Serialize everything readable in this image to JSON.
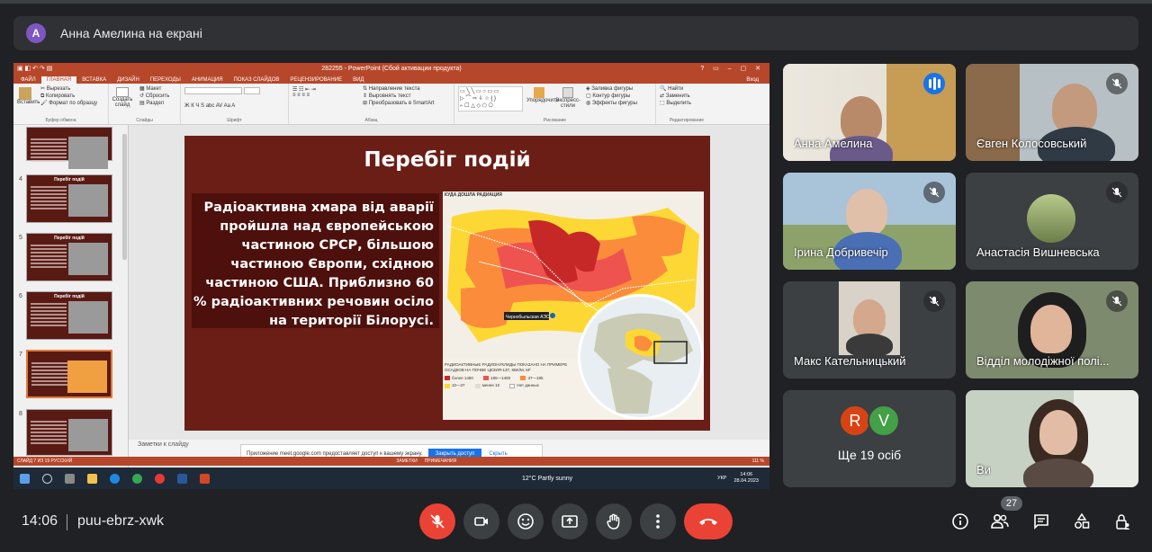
{
  "presenter": {
    "initial": "А",
    "label": "Анна Амелина на екрані"
  },
  "powerpoint": {
    "title": "282255 - PowerPoint (Сбой активации продукта)",
    "tabs": [
      "ФАЙЛ",
      "ГЛАВНАЯ",
      "ВСТАВКА",
      "ДИЗАЙН",
      "ПЕРЕХОДЫ",
      "АНИМАЦИЯ",
      "ПОКАЗ СЛАЙДОВ",
      "РЕЦЕНЗИРОВАНИЕ",
      "ВИД"
    ],
    "login": "Вход",
    "ribbon": {
      "clipboard": {
        "paste": "Вставить",
        "cut": "Вырезать",
        "copy": "Копировать",
        "format": "Формат по образцу",
        "label": "Буфер обмена"
      },
      "slides": {
        "new": "Создать слайд",
        "layout": "Макет",
        "reset": "Сбросить",
        "section": "Раздел",
        "label": "Слайды"
      },
      "font": {
        "label": "Шрифт"
      },
      "paragraph": {
        "direction": "Направление текста",
        "align": "Выровнять текст",
        "smartart": "Преобразовать в SmartArt",
        "label": "Абзац"
      },
      "drawing": {
        "arrange": "Упорядочить",
        "quick": "Экспресс-стили",
        "fill": "Заливка фигуры",
        "outline": "Контур фигуры",
        "effects": "Эффекты фигуры",
        "label": "Рисование"
      },
      "editing": {
        "find": "Найти",
        "replace": "Заменить",
        "select": "Выделить",
        "label": "Редактирование"
      }
    },
    "thumbnails": [
      {
        "num": "",
        "title": ""
      },
      {
        "num": "4",
        "title": "Перебіг подій"
      },
      {
        "num": "5",
        "title": "Перебіг подій"
      },
      {
        "num": "6",
        "title": "Перебіг подій"
      },
      {
        "num": "7",
        "title": "Перебіг подій"
      },
      {
        "num": "8",
        "title": ""
      }
    ],
    "slide": {
      "title": "Перебіг подій",
      "text": "Радіоактивна хмара від аварії пройшла над європейською частиною СРСР, більшою частиною Європи, східною частиною США. Приблизно 60 % радіоактивних речовин осіло на території Білорусі.",
      "map": {
        "heading": "КУДА ДОШЛА РАДИАЦИЯ",
        "plant_label": "Чернобыльская АЭС",
        "legend_title": "РАДИОАКТИВНЫЕ РАДИОНУКЛИДЫ ПОКАЗАНО НА ПРИМЕРЕ ОСАДКОВ НА ПОЧВЕ ЦЕЗИЯ-137, КБК/М, М²",
        "legend": [
          {
            "label": "более 1480",
            "color": "#c62828"
          },
          {
            "label": "185—1480",
            "color": "#ef5350"
          },
          {
            "label": "37—185",
            "color": "#fb8c3c"
          },
          {
            "label": "10—37",
            "color": "#fdd835"
          },
          {
            "label": "менее 10",
            "color": "#e0dcd0"
          },
          {
            "label": "Нет данных",
            "color": "#ffffff"
          }
        ]
      }
    },
    "notes_placeholder": "Заметки к слайду",
    "share_banner": {
      "text": "Приложение meet.google.com предоставляет доступ к вашему экрану.",
      "allow": "Закрыть доступ",
      "hide": "Скрыть"
    },
    "status": {
      "left": "СЛАЙД 7 ИЗ 19    РУССКИЙ",
      "notes": "ЗАМЕТКИ",
      "comments": "ПРИМЕЧАНИЯ",
      "zoom": "111 %"
    },
    "taskbar": {
      "weather": "12°C  Partly sunny",
      "lang": "УКР",
      "time": "14:06",
      "date": "28.04.2023"
    }
  },
  "participants": [
    {
      "name": "Анна Амелина",
      "speaking": true
    },
    {
      "name": "Євген Колосовський",
      "muted": true
    },
    {
      "name": "Ірина Добривечір",
      "muted": true
    },
    {
      "name": "Анастасія Вишневська",
      "muted": true
    },
    {
      "name": "Макс Кательницький",
      "muted": true
    },
    {
      "name": "Відділ молодіжної полі...",
      "muted": true
    },
    {
      "name": "Ви"
    }
  ],
  "others": {
    "initials": [
      "R",
      "V"
    ],
    "colors": [
      "#d84315",
      "#43a047"
    ],
    "label": "Ще 19 осіб"
  },
  "meeting": {
    "time": "14:06",
    "code": "puu-ebrz-xwk",
    "participants_count": "27"
  }
}
